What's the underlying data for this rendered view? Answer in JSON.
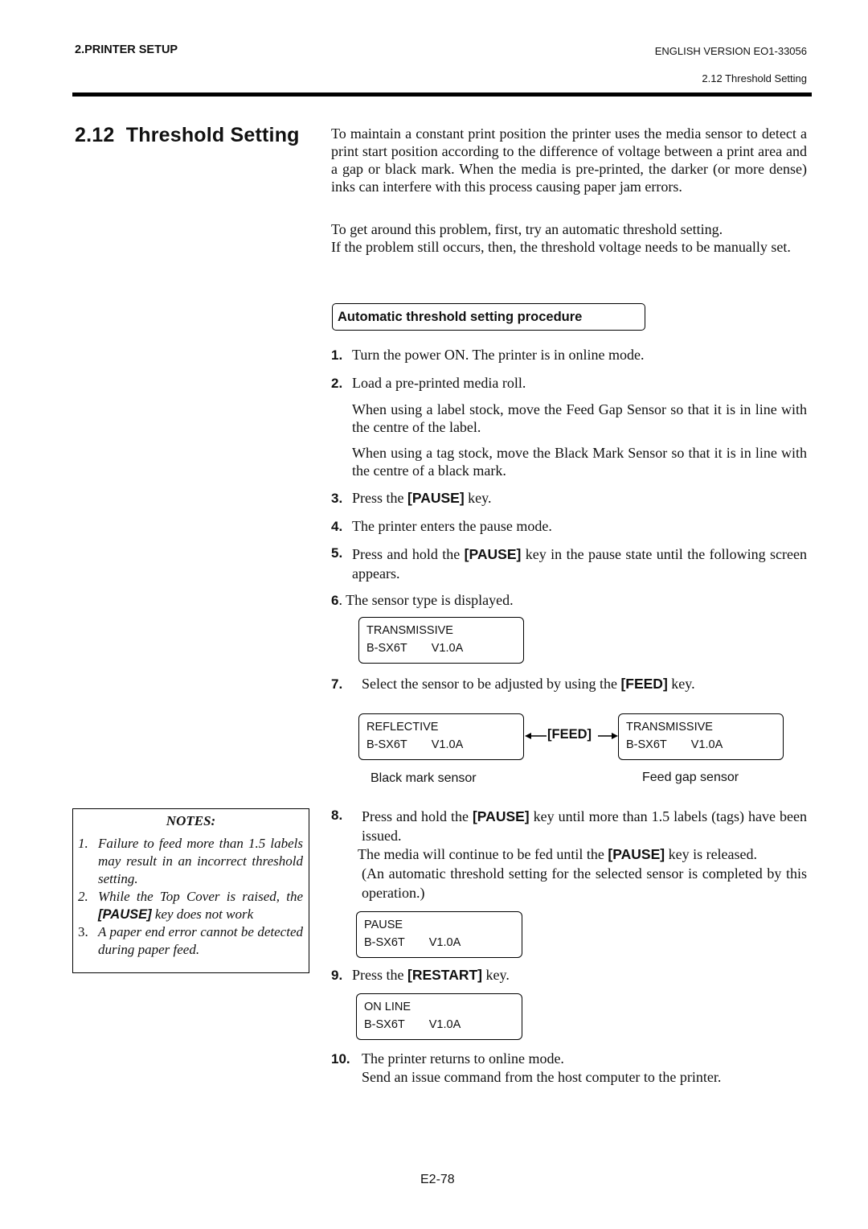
{
  "header": {
    "section": "2.PRINTER SETUP",
    "version": "ENGLISH VERSION EO1-33056",
    "subsection": "2.12 Threshold Setting"
  },
  "title": "2.12  Threshold Setting",
  "intro": {
    "p1": "To maintain a constant print position the printer uses the media sensor to detect a print start position according to the difference of voltage between a print area and a gap or black mark.  When the media is pre-printed, the darker (or more dense) inks can interfere with this process causing paper jam errors.",
    "p2a": "To get around this problem, first, try an automatic threshold setting.",
    "p2b": "If the problem still occurs, then, the threshold voltage needs to be manually set."
  },
  "procedure_heading": "Automatic threshold setting procedure",
  "steps": {
    "s1": {
      "num": "1.",
      "text": "Turn the power ON.  The printer is in online mode."
    },
    "s2": {
      "num": "2.",
      "text": "Load a pre-printed media roll.",
      "sub1": "When using a label stock, move the Feed Gap Sensor so that it is in line with the centre of the label.",
      "sub2": "When using a tag stock, move the Black Mark Sensor so that it is in line with the centre of a black mark."
    },
    "s3": {
      "num": "3.",
      "pre": "Press the ",
      "key": "[PAUSE]",
      "post": " key."
    },
    "s4": {
      "num": "4.",
      "text": "The printer enters the pause mode."
    },
    "s5": {
      "num": "5.",
      "pre": "Press and hold the ",
      "key": "[PAUSE]",
      "post": " key in the pause state until the following screen appears."
    },
    "s6": {
      "num": "6",
      "text": ". The sensor type is displayed."
    },
    "s7": {
      "num": "7.",
      "pre": "Select the sensor to be adjusted by using the ",
      "key": "[FEED]",
      "post": " key."
    },
    "s8": {
      "num": "8.",
      "pre": "Press and hold the ",
      "key": "[PAUSE]",
      "post": " key until more than 1.5 labels (tags) have been issued.",
      "line2_pre": "The media will continue to be fed until the ",
      "line2_key": "[PAUSE]",
      "line2_post": " key is released.",
      "line3": "(An automatic threshold setting for the selected sensor is completed by this operation.)"
    },
    "s9": {
      "num": "9.",
      "pre": "Press the ",
      "key": "[RESTART]",
      "post": " key."
    },
    "s10": {
      "num": "10.",
      "text": "The printer returns to online mode.",
      "line2": "Send an issue command from the host computer to the printer."
    }
  },
  "lcd": {
    "sensor_display": {
      "line1": "TRANSMISSIVE",
      "model": "B-SX6T",
      "version": "V1.0A"
    },
    "reflective": {
      "line1": "REFLECTIVE",
      "model": "B-SX6T",
      "version": "V1.0A"
    },
    "transmissive": {
      "line1": "TRANSMISSIVE",
      "model": "B-SX6T",
      "version": "V1.0A"
    },
    "pause": {
      "line1": "PAUSE",
      "model": "B-SX6T",
      "version": "V1.0A"
    },
    "online": {
      "line1": "ON LINE",
      "model": "B-SX6T",
      "version": "V1.0A"
    }
  },
  "feed_diagram": {
    "key_label": "[FEED]",
    "left_caption": "Black mark sensor",
    "right_caption": "Feed gap sensor"
  },
  "notes": {
    "title": "NOTES:",
    "n1": {
      "num": "1.",
      "text": "Failure to feed more than 1.5 labels may result in an incorrect threshold setting."
    },
    "n2": {
      "num": "2.",
      "pre": "While the Top Cover is raised, the ",
      "key": "[PAUSE]",
      "post": " key does not work"
    },
    "n3": {
      "num": "3.",
      "text": "A paper end error cannot be detected during paper feed."
    }
  },
  "footer": {
    "page": "E2-78"
  }
}
